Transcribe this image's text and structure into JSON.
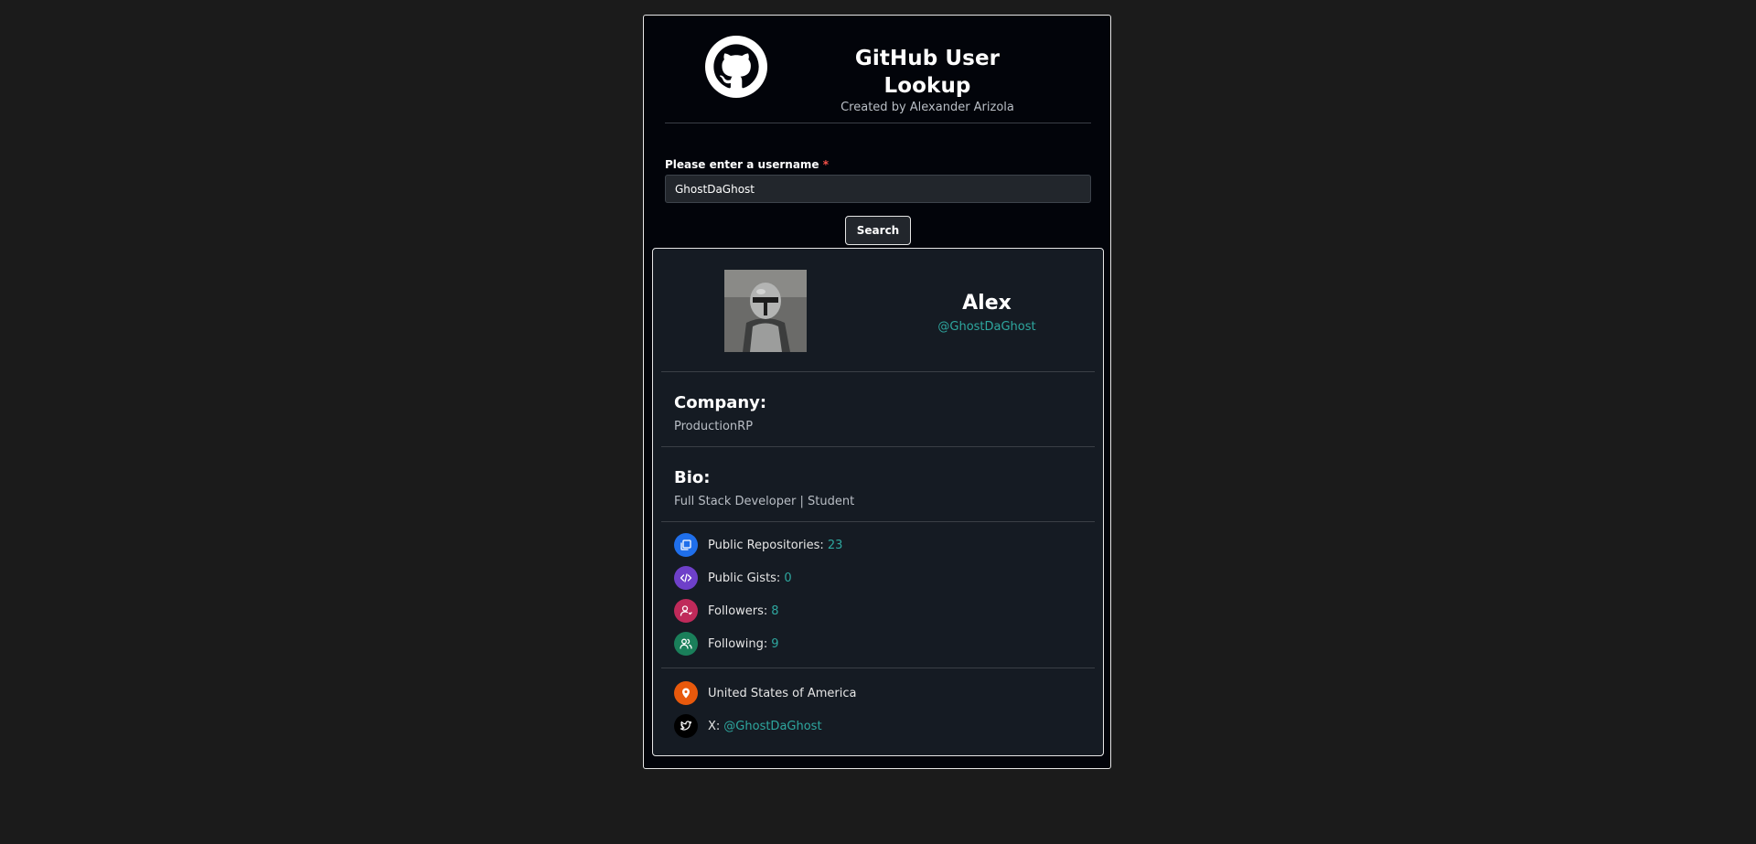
{
  "header": {
    "title": "GitHub User Lookup",
    "subtitle": "Created by Alexander Arizola",
    "logo_icon": "github-octocat-icon"
  },
  "form": {
    "label": "Please enter a username",
    "required_marker": "*",
    "username_value": "GhostDaGhost",
    "search_label": "Search"
  },
  "profile": {
    "name": "Alex",
    "login": "@GhostDaGhost",
    "company_heading": "Company:",
    "company": "ProductionRP",
    "bio_heading": "Bio:",
    "bio": "Full Stack Developer | Student",
    "stats": [
      {
        "label": "Public Repositories:",
        "value": "23",
        "icon": "repositories-icon",
        "color": "#1f6feb"
      },
      {
        "label": "Public Gists:",
        "value": "0",
        "icon": "code-icon",
        "color": "#6e40c9"
      },
      {
        "label": "Followers:",
        "value": "8",
        "icon": "followers-icon",
        "color": "#bf2a5a"
      },
      {
        "label": "Following:",
        "value": "9",
        "icon": "following-icon",
        "color": "#1a7f5a"
      }
    ],
    "location": "United States of America",
    "location_icon": "location-pin-icon",
    "location_color": "#e8590c",
    "social_label": "X:",
    "social_handle": "@GhostDaGhost",
    "social_icon": "twitter-icon",
    "social_color": "#000000"
  },
  "colors": {
    "accent": "#2ea79f",
    "background": "#1b1b1b",
    "panel": "#02040a",
    "card": "#151b23"
  }
}
